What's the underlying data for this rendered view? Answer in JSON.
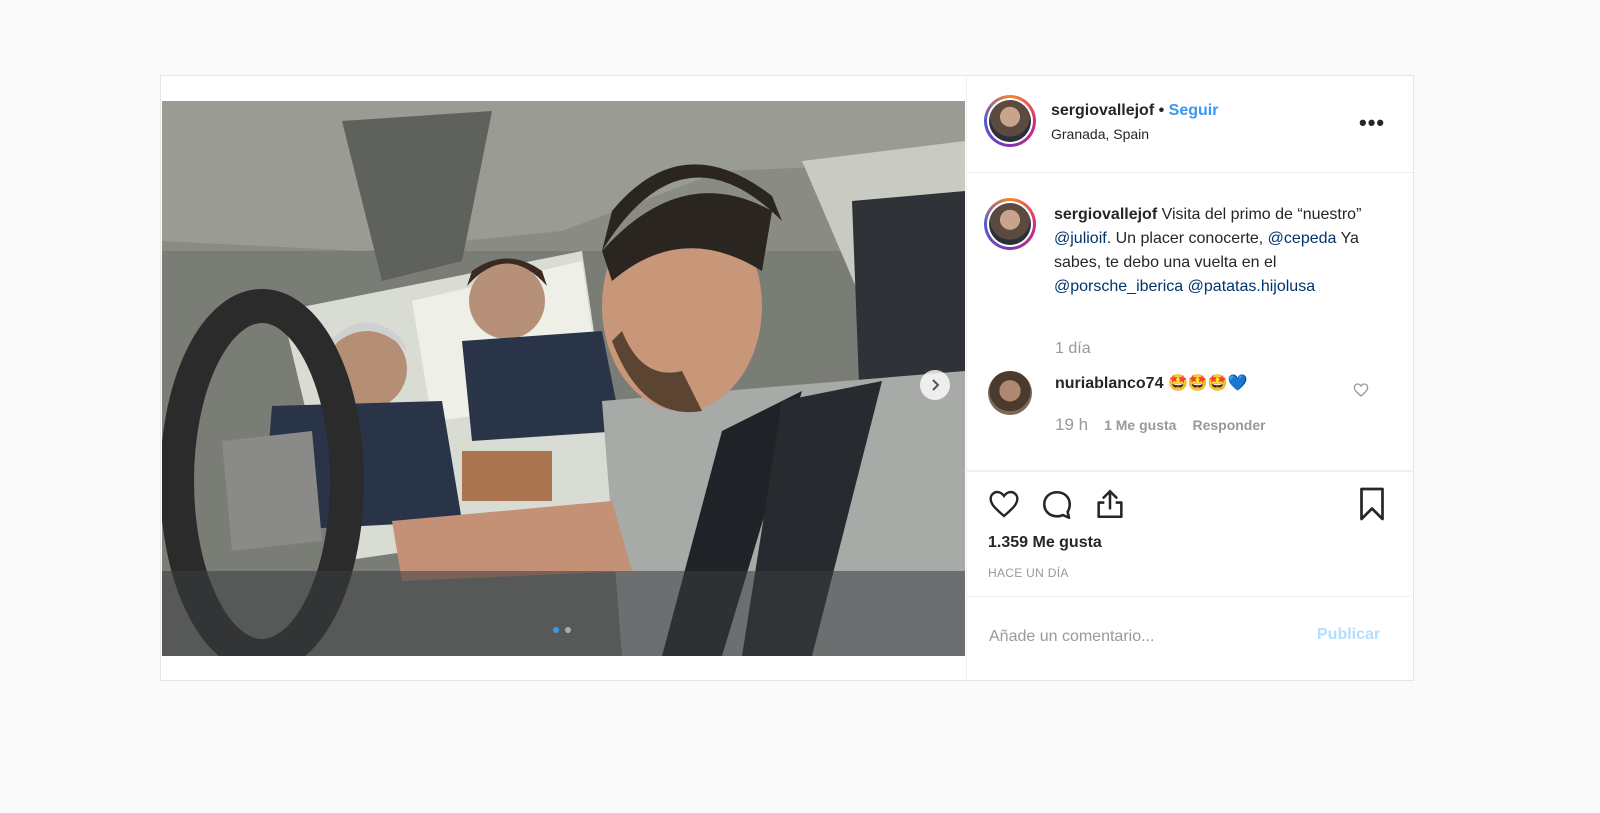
{
  "post": {
    "header": {
      "username": "sergiovallejof",
      "separator": " • ",
      "follow_label": "Seguir",
      "location": "Granada, Spain",
      "more_icon": "more-options-icon"
    },
    "caption": {
      "username": "sergiovallejof",
      "text_1": " Visita del primo de “nuestro” ",
      "mention_1": "@julioif",
      "text_2": ". Un placer conocerte, ",
      "mention_2": "@cepeda",
      "text_3": " Ya sabes, te debo una vuelta en el ",
      "mention_3": "@porsche_iberica",
      "text_4": " ",
      "mention_4": "@patatas.hijolusa",
      "time": "1 día"
    },
    "comment": {
      "username": "nuriablanco74",
      "text": "🤩🤩🤩💙",
      "time": "19 h",
      "likes": "1 Me gusta",
      "reply": "Responder"
    },
    "likes": "1.359 Me gusta",
    "date": "HACE UN DÍA",
    "add_comment": {
      "placeholder": "Añade un comentario...",
      "publish": "Publicar"
    },
    "carousel": {
      "current": 1,
      "total": 2
    },
    "colors": {
      "link": "#3897f0",
      "mention": "#003569",
      "muted": "#999999"
    }
  }
}
